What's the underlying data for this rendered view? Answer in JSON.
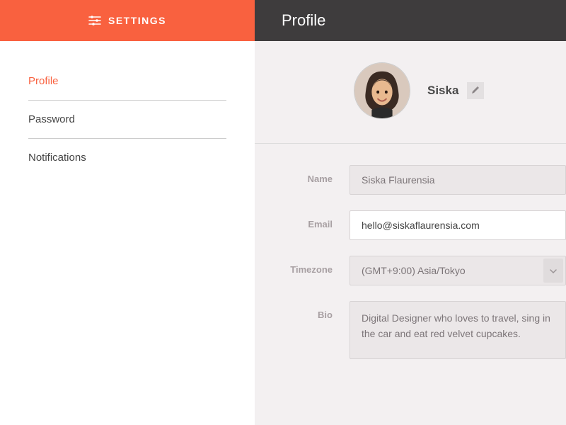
{
  "colors": {
    "accent": "#F9613F",
    "header_dark": "#3E3C3D",
    "panel_bg": "#F3F0F1"
  },
  "sidebar": {
    "title": "SETTINGS",
    "items": [
      {
        "label": "Profile",
        "active": true
      },
      {
        "label": "Password",
        "active": false
      },
      {
        "label": "Notifications",
        "active": false
      }
    ]
  },
  "header": {
    "title": "Profile"
  },
  "profile": {
    "display_name": "Siska",
    "fields": {
      "name": {
        "label": "Name",
        "value": "Siska Flaurensia"
      },
      "email": {
        "label": "Email",
        "value": "hello@siskaflaurensia.com"
      },
      "timezone": {
        "label": "Timezone",
        "value": "(GMT+9:00) Asia/Tokyo"
      },
      "bio": {
        "label": "Bio",
        "value": "Digital Designer who loves to travel, sing in the car and eat red velvet cupcakes."
      }
    }
  }
}
